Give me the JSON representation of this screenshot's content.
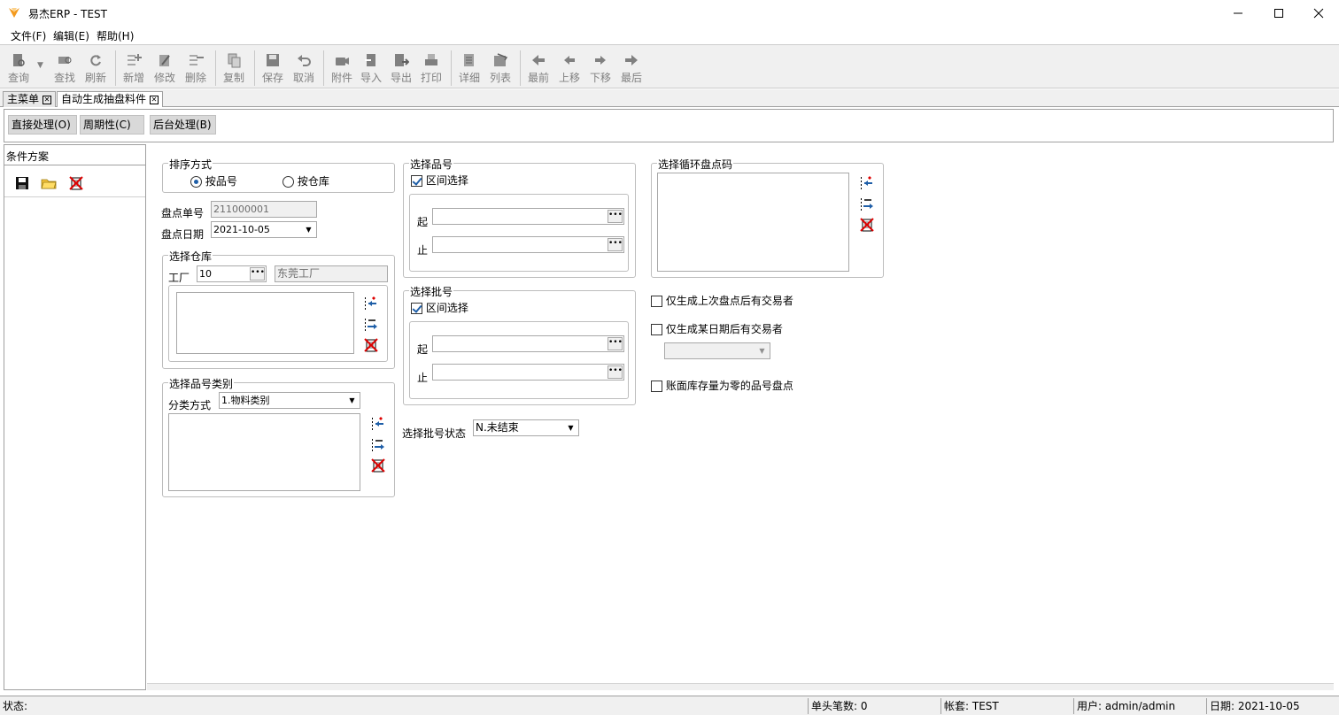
{
  "window": {
    "title": "易杰ERP - TEST",
    "min_icon": "minimize-icon",
    "max_icon": "maximize-icon",
    "close_icon": "close-icon"
  },
  "menu": [
    "文件(F)",
    "编辑(E)",
    "帮助(H)"
  ],
  "toolbar": [
    {
      "label": "查询",
      "icon": "query-icon"
    },
    {
      "label": "查找",
      "icon": "find-icon"
    },
    {
      "label": "刷新",
      "icon": "refresh-icon"
    },
    {
      "label": "新增",
      "icon": "add-icon"
    },
    {
      "label": "修改",
      "icon": "edit-icon"
    },
    {
      "label": "删除",
      "icon": "delete-icon"
    },
    {
      "label": "复制",
      "icon": "copy-icon"
    },
    {
      "label": "保存",
      "icon": "save-icon"
    },
    {
      "label": "取消",
      "icon": "undo-icon"
    },
    {
      "label": "附件",
      "icon": "attachment-icon"
    },
    {
      "label": "导入",
      "icon": "import-icon"
    },
    {
      "label": "导出",
      "icon": "export-icon"
    },
    {
      "label": "打印",
      "icon": "print-icon"
    },
    {
      "label": "详细",
      "icon": "detail-icon"
    },
    {
      "label": "列表",
      "icon": "list-icon"
    },
    {
      "label": "最前",
      "icon": "first-icon"
    },
    {
      "label": "上移",
      "icon": "up-icon"
    },
    {
      "label": "下移",
      "icon": "down-icon"
    },
    {
      "label": "最后",
      "icon": "last-icon"
    }
  ],
  "tabs": [
    "主菜单",
    "自动生成抽盘料件"
  ],
  "modes": [
    "直接处理(O)",
    "周期性(C)",
    "后台处理(B)"
  ],
  "left": {
    "title": "条件方案"
  },
  "sort": {
    "title": "排序方式",
    "opt1": "按品号",
    "opt2": "按仓库"
  },
  "count": {
    "no_label": "盘点单号",
    "no_value": "211000001",
    "date_label": "盘点日期",
    "date_value": "2021-10-05"
  },
  "warehouse": {
    "title": "选择仓库",
    "factory_label": "工厂",
    "factory_code": "10",
    "factory_name": "东莞工厂"
  },
  "category": {
    "title": "选择品号类别",
    "method_label": "分类方式",
    "method_value": "1.物料类别"
  },
  "item": {
    "title": "选择品号",
    "range": "区间选择",
    "from": "起",
    "to": "止"
  },
  "batch": {
    "title": "选择批号",
    "range": "区间选择",
    "from": "起",
    "to": "止"
  },
  "batch_status": {
    "label": "选择批号状态",
    "value": "N.未结束"
  },
  "cycle": {
    "title": "选择循环盘点码"
  },
  "options": {
    "opt1": "仅生成上次盘点后有交易者",
    "opt2": "仅生成某日期后有交易者",
    "opt3": "账面库存量为零的品号盘点"
  },
  "status": {
    "label": "状态:",
    "records": "单头笔数: 0",
    "account": "帐套: TEST",
    "user": "用户: admin/admin",
    "date": "日期: 2021-10-05"
  }
}
